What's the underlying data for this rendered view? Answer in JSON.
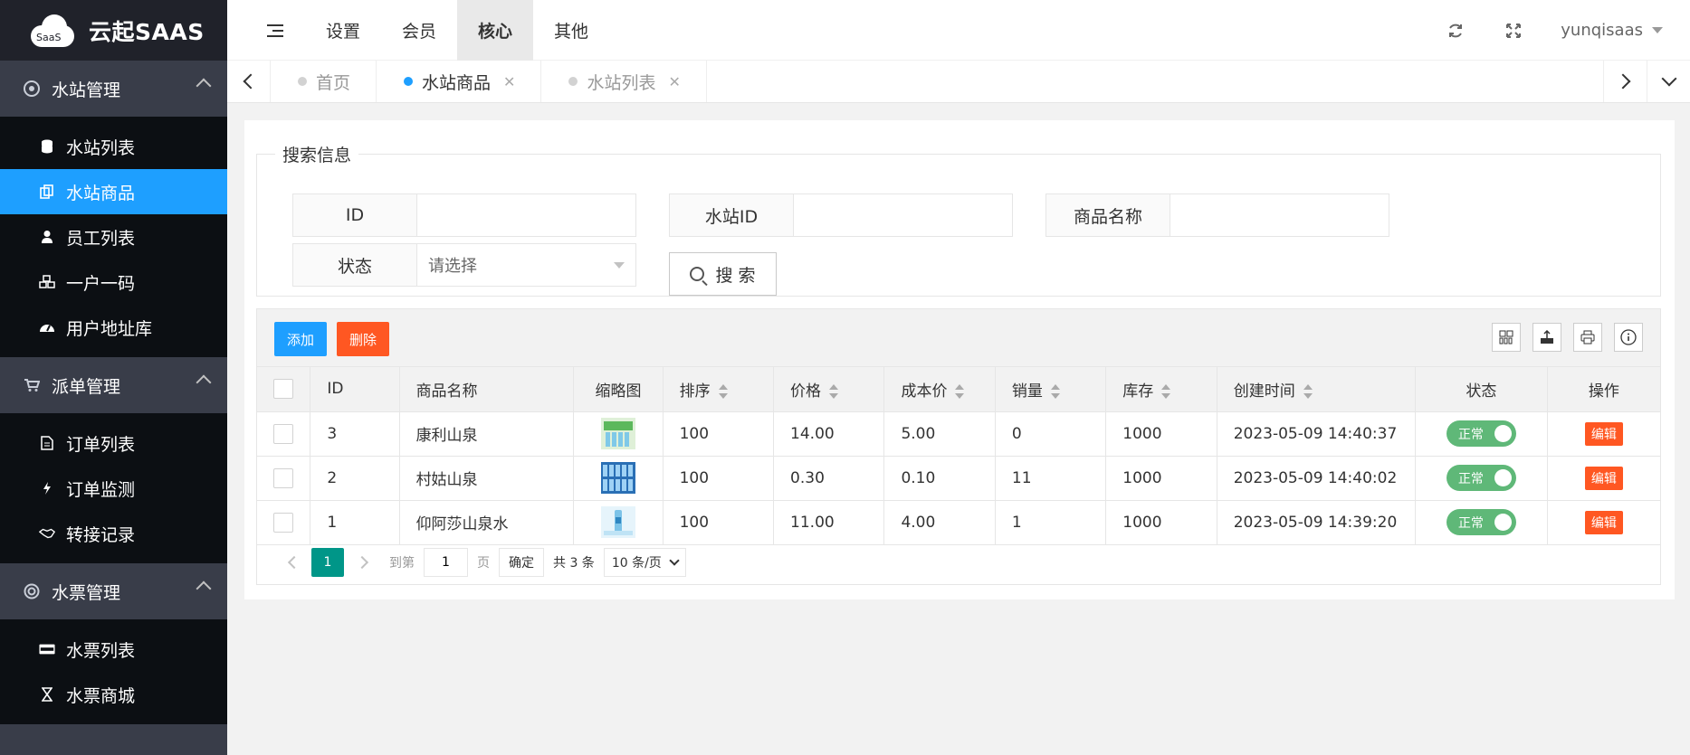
{
  "app": {
    "logo_badge": "SaaS",
    "title": "云起SAAS"
  },
  "sidebar": {
    "groups": [
      {
        "title": "水站管理",
        "icon": "chrome-icon",
        "items": [
          {
            "label": "水站列表",
            "icon": "database-icon"
          },
          {
            "label": "水站商品",
            "icon": "copy-icon",
            "active": true
          },
          {
            "label": "员工列表",
            "icon": "user-icon"
          },
          {
            "label": "一户一码",
            "icon": "cubes-icon"
          },
          {
            "label": "用户地址库",
            "icon": "dashboard-icon"
          }
        ]
      },
      {
        "title": "派单管理",
        "icon": "cart-icon",
        "items": [
          {
            "label": "订单列表",
            "icon": "file-icon"
          },
          {
            "label": "订单监测",
            "icon": "bolt-icon"
          },
          {
            "label": "转接记录",
            "icon": "handshake-icon"
          }
        ]
      },
      {
        "title": "水票管理",
        "icon": "lifebuoy-icon",
        "items": [
          {
            "label": "水票列表",
            "icon": "visa-icon"
          },
          {
            "label": "水票商城",
            "icon": "hourglass-icon"
          }
        ]
      }
    ]
  },
  "header": {
    "tabs": [
      "设置",
      "会员",
      "核心",
      "其他"
    ],
    "active_tab": "核心",
    "username": "yunqisaas"
  },
  "tabbar": {
    "tabs": [
      {
        "label": "首页",
        "active": false,
        "closable": false
      },
      {
        "label": "水站商品",
        "active": true,
        "closable": true
      },
      {
        "label": "水站列表",
        "active": false,
        "closable": true
      }
    ]
  },
  "search": {
    "legend": "搜索信息",
    "fields": {
      "id_label": "ID",
      "id_value": "",
      "station_label": "水站ID",
      "station_value": "",
      "name_label": "商品名称",
      "name_value": "",
      "status_label": "状态",
      "status_placeholder": "请选择"
    },
    "button": "搜 索"
  },
  "toolbar": {
    "add": "添加",
    "delete": "删除"
  },
  "table": {
    "columns": [
      "ID",
      "商品名称",
      "缩略图",
      "排序",
      "价格",
      "成本价",
      "销量",
      "库存",
      "创建时间",
      "状态",
      "操作"
    ],
    "rows": [
      {
        "id": "3",
        "name": "康利山泉",
        "sort": "100",
        "price": "14.00",
        "cost": "5.00",
        "sales": "0",
        "stock": "1000",
        "created": "2023-05-09 14:40:37",
        "status": "正常",
        "action": "编辑"
      },
      {
        "id": "2",
        "name": "村姑山泉",
        "sort": "100",
        "price": "0.30",
        "cost": "0.10",
        "sales": "11",
        "stock": "1000",
        "created": "2023-05-09 14:40:02",
        "status": "正常",
        "action": "编辑"
      },
      {
        "id": "1",
        "name": "仰阿莎山泉水",
        "sort": "100",
        "price": "11.00",
        "cost": "4.00",
        "sales": "1",
        "stock": "1000",
        "created": "2023-05-09 14:39:20",
        "status": "正常",
        "action": "编辑"
      }
    ]
  },
  "pager": {
    "current": "1",
    "goto_label": "到第",
    "goto_value": "1",
    "page_label": "页",
    "confirm": "确定",
    "total": "共 3 条",
    "limit": "10 条/页"
  },
  "colors": {
    "sidebar": "#393d49",
    "sidebar_dark": "#20222a",
    "active": "#1e9fff",
    "danger": "#ff5722",
    "switch_on": "#5fb878",
    "pager_active": "#009688"
  }
}
